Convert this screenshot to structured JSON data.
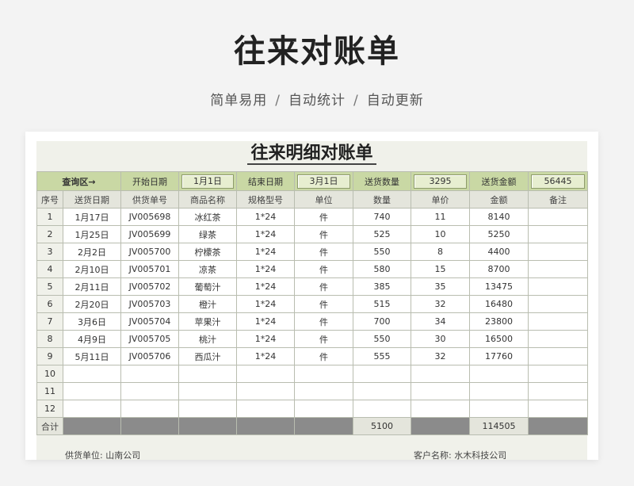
{
  "page": {
    "title": "往来对账单",
    "subtitle": [
      "简单易用",
      "自动统计",
      "自动更新"
    ],
    "subtitle_sep": "/"
  },
  "sheet": {
    "title": "往来明细对账单",
    "query": {
      "label": "查询区→",
      "start_label": "开始日期",
      "start_value": "1月1日",
      "end_label": "结束日期",
      "end_value": "3月1日",
      "qty_label": "送货数量",
      "qty_value": "3295",
      "amount_label": "送货金额",
      "amount_value": "56445"
    },
    "columns": [
      "序号",
      "送货日期",
      "供货单号",
      "商品名称",
      "规格型号",
      "单位",
      "数量",
      "单价",
      "金额",
      "备注"
    ],
    "rows": [
      [
        "1",
        "1月17日",
        "JV005698",
        "冰红茶",
        "1*24",
        "件",
        "740",
        "11",
        "8140",
        ""
      ],
      [
        "2",
        "1月25日",
        "JV005699",
        "绿茶",
        "1*24",
        "件",
        "525",
        "10",
        "5250",
        ""
      ],
      [
        "3",
        "2月2日",
        "JV005700",
        "柠檬茶",
        "1*24",
        "件",
        "550",
        "8",
        "4400",
        ""
      ],
      [
        "4",
        "2月10日",
        "JV005701",
        "凉茶",
        "1*24",
        "件",
        "580",
        "15",
        "8700",
        ""
      ],
      [
        "5",
        "2月11日",
        "JV005702",
        "葡萄汁",
        "1*24",
        "件",
        "385",
        "35",
        "13475",
        ""
      ],
      [
        "6",
        "2月20日",
        "JV005703",
        "橙汁",
        "1*24",
        "件",
        "515",
        "32",
        "16480",
        ""
      ],
      [
        "7",
        "3月6日",
        "JV005704",
        "苹果汁",
        "1*24",
        "件",
        "700",
        "34",
        "23800",
        ""
      ],
      [
        "8",
        "4月9日",
        "JV005705",
        "桃汁",
        "1*24",
        "件",
        "550",
        "30",
        "16500",
        ""
      ],
      [
        "9",
        "5月11日",
        "JV005706",
        "西瓜汁",
        "1*24",
        "件",
        "555",
        "32",
        "17760",
        ""
      ],
      [
        "10",
        "",
        "",
        "",
        "",
        "",
        "",
        "",
        "",
        ""
      ],
      [
        "11",
        "",
        "",
        "",
        "",
        "",
        "",
        "",
        "",
        ""
      ],
      [
        "12",
        "",
        "",
        "",
        "",
        "",
        "",
        "",
        "",
        ""
      ]
    ],
    "total": {
      "label": "合计",
      "qty": "5100",
      "amount": "114505"
    },
    "footer": {
      "supplier": "供货单位:  山南公司",
      "customer": "客户名称:  水木科技公司"
    }
  }
}
